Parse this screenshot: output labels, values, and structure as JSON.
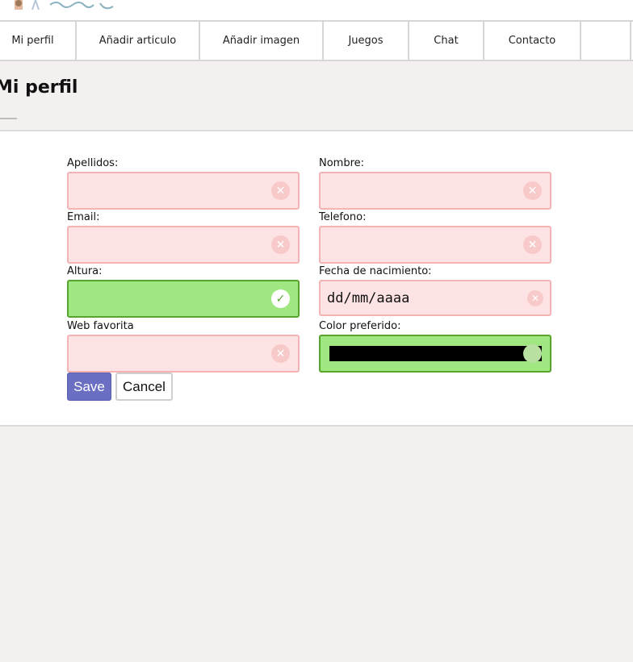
{
  "nav": {
    "items": [
      {
        "label": "Mi perfil"
      },
      {
        "label": "Añadir articulo"
      },
      {
        "label": "Añadir imagen"
      },
      {
        "label": "Juegos"
      },
      {
        "label": "Chat"
      },
      {
        "label": "Contacto"
      },
      {
        "label": ""
      }
    ]
  },
  "page": {
    "title": "Mi perfil"
  },
  "form": {
    "apellidos_label": "Apellidos:",
    "nombre_label": "Nombre:",
    "email_label": "Email:",
    "telefono_label": "Telefono:",
    "altura_label": "Altura:",
    "fecha_label": "Fecha de nacimiento:",
    "fecha_placeholder": "dd/mm/aaaa",
    "web_label": "Web favorita",
    "color_label": "Color preferido:",
    "color_value": "#000000",
    "invalid_bg": "#fde3e3",
    "valid_bg": "#a1e781"
  },
  "buttons": {
    "save": "Save",
    "cancel": "Cancel",
    "save_color": "#6b6fc2"
  },
  "icons": {
    "invalid": "clear-x-icon",
    "valid": "checkmark-icon"
  }
}
